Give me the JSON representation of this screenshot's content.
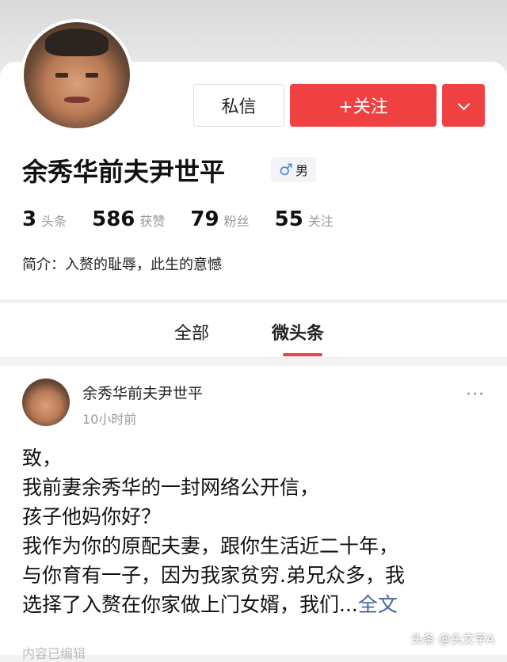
{
  "profile": {
    "name": "余秀华前夫尹世平",
    "gender": {
      "symbol": "♂",
      "label": "男"
    },
    "buttons": {
      "message": "私信",
      "follow": "+关注"
    },
    "stats": [
      {
        "num": "3",
        "label": "头条"
      },
      {
        "num": "586",
        "label": "获赞"
      },
      {
        "num": "79",
        "label": "粉丝"
      },
      {
        "num": "55",
        "label": "关注"
      }
    ],
    "bio": "简介：入赘的耻辱，此生的意憾"
  },
  "tabs": [
    {
      "label": "全部"
    },
    {
      "label": "微头条"
    }
  ],
  "post": {
    "author": "余秀华前夫尹世平",
    "time": "10小时前",
    "more": "···",
    "lines": [
      "致，",
      "我前妻余秀华的一封网络公开信，",
      "孩子他妈你好？",
      "我作为你的原配夫妻，跟你生活近二十年，",
      "与你育有一子，因为我家贫穷.弟兄众多，我",
      "选择了入赘在你家做上门女婿，我们..."
    ],
    "full_link": "全文",
    "edited": "内容已编辑"
  },
  "watermark": "头条 @头文字A",
  "colors": {
    "accent": "#f04142",
    "link": "#406599"
  }
}
